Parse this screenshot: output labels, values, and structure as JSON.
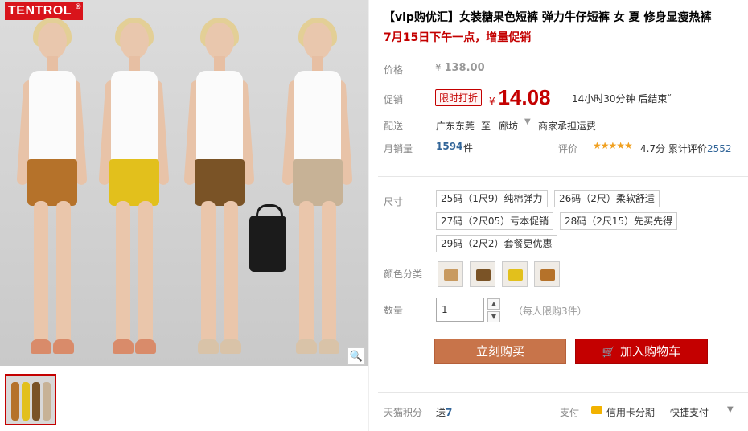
{
  "gallery": {
    "brand_logo": "TENTROL",
    "brand_mark": "®",
    "zoom_icon": "🔍",
    "models": [
      {
        "shorts_color": "#b5722a"
      },
      {
        "shorts_color": "#e2c01c"
      },
      {
        "shorts_color": "#7a5326"
      },
      {
        "shorts_color": "#c7b296"
      }
    ]
  },
  "product": {
    "title": "【vip购优汇】女装糖果色短裤 弹力牛仔短裤 女 夏 修身显瘦热裤",
    "promo_text": "7月15日下午一点，增量促销"
  },
  "price": {
    "label": "价格",
    "currency": "¥",
    "original": "138.00"
  },
  "promotion": {
    "label": "促销",
    "tag": "限时打折",
    "currency": "¥",
    "price": "14.08",
    "countdown": "14小时30分钟 后结束",
    "countdown_arrow": "˅"
  },
  "shipping": {
    "label": "配送",
    "from": "广东东莞",
    "to_word": "至",
    "to": "廊坊",
    "arrow": "▼",
    "note": "商家承担运费"
  },
  "sales": {
    "label": "月销量",
    "count": "1594",
    "unit": "件",
    "review_label": "评价",
    "stars": "★★★★★",
    "score": "4.7分",
    "total_label": "累计评价",
    "total_count": "2552"
  },
  "size": {
    "label": "尺寸",
    "options": [
      "25码（1尺9）纯棉弹力",
      "26码（2尺）柔软舒适",
      "27码（2尺05）亏本促销",
      "28码（2尺15）先买先得",
      "29码（2尺2）套餐更优惠"
    ]
  },
  "color": {
    "label": "颜色分类",
    "swatches": [
      "#c89a60",
      "#7a5326",
      "#e2c01c",
      "#b5722a"
    ]
  },
  "quantity": {
    "label": "数量",
    "value": "1",
    "up": "▲",
    "down": "▼",
    "limit": "（每人限购3件）"
  },
  "actions": {
    "buy_now": "立刻购买",
    "add_cart": "加入购物车",
    "cart_icon": "🛒"
  },
  "footer": {
    "points_label": "天猫积分",
    "points_prefix": "送",
    "points_value": "7",
    "pay_label": "支付",
    "credit": "信用卡分期",
    "quick_pay": "快捷支付",
    "arrow": "▼"
  }
}
